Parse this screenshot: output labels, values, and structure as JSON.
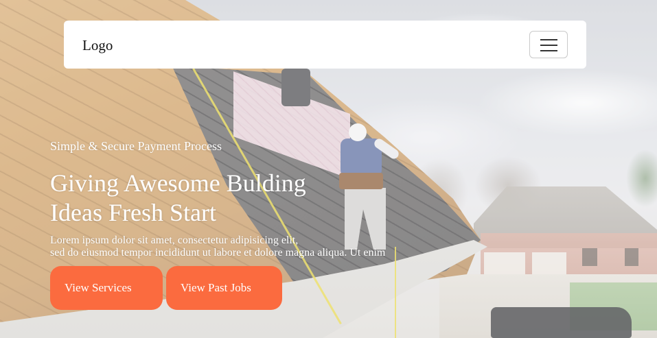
{
  "navbar": {
    "logo": "Logo",
    "toggle_icon": "hamburger-menu-icon"
  },
  "hero": {
    "subtitle": "Simple & Secure Payment Process",
    "headline_line1": "Giving Awesome Bulding",
    "headline_line2": "Ideas Fresh Start",
    "lead_line1": "Lorem ipsum dolor sit amet, consectetur adipisicing elit,",
    "lead_line2": "sed do eiusmod tempor incididunt ut labore et dolore magna aliqua. Ut enim",
    "buttons": [
      {
        "label": "View Services"
      },
      {
        "label": "View Past Jobs"
      }
    ]
  },
  "colors": {
    "accent": "#fb6b3f",
    "navbar_bg": "#ffffff",
    "hero_text": "#ffffff"
  }
}
